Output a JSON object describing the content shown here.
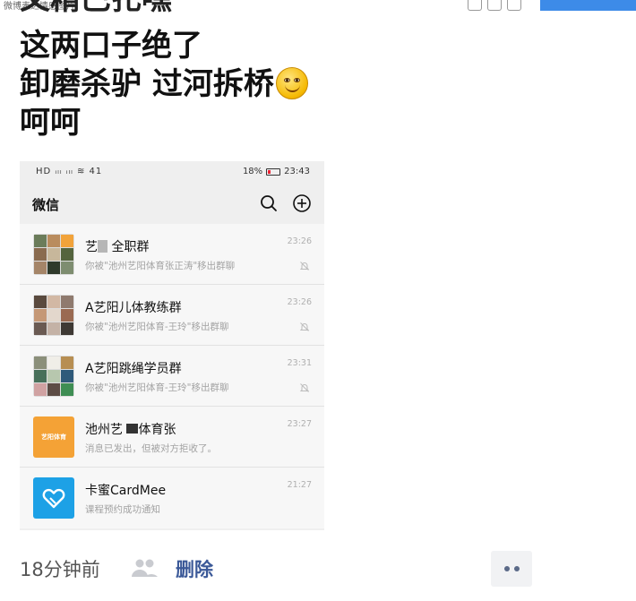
{
  "page": {
    "breadcrumb": "微博表达情感图片",
    "cut_text": "又精巴扎嘿",
    "post_lines": [
      "这两口子绝了",
      "卸磨杀驴 过河拆桥",
      "呵呵"
    ],
    "smiley_icon": "smiley-emoji"
  },
  "phone": {
    "status_left": "HD ᵢₗₗ ᵢₗₗ ≋ 41",
    "battery": "18%",
    "clock": "23:43",
    "app_title": "微信",
    "chats": [
      {
        "name_a": "艺",
        "name_b": " 全职群",
        "preview": "你被\"池州艺阳体育张正涛\"移出群聊",
        "time": "23:26",
        "muted": true
      },
      {
        "name_a": "A艺",
        "name_b": "阳儿体教练群",
        "preview": "你被\"池州艺阳体育-王玲\"移出群聊",
        "time": "23:26",
        "muted": true
      },
      {
        "name_a": "A艺",
        "name_b": "阳跳绳学员群",
        "preview": "你被\"池州艺阳体育-王玲\"移出群聊",
        "time": "23:31",
        "muted": true
      },
      {
        "name_a": "池州艺",
        "name_b": "体育张",
        "preview": "消息已发出，但被对方拒收了。",
        "time": "23:27",
        "muted": false,
        "avatar_text": "艺阳体育"
      },
      {
        "name_a": "卡蜜CardMee",
        "name_b": "",
        "preview": "课程预约成功通知",
        "time": "21:27",
        "muted": false
      }
    ]
  },
  "footer": {
    "time_ago": "18分钟前",
    "delete_label": "删除"
  },
  "colors": {
    "link": "#3b5998",
    "wechat_bg": "#efefef",
    "accent_blue": "#3d8be8"
  }
}
